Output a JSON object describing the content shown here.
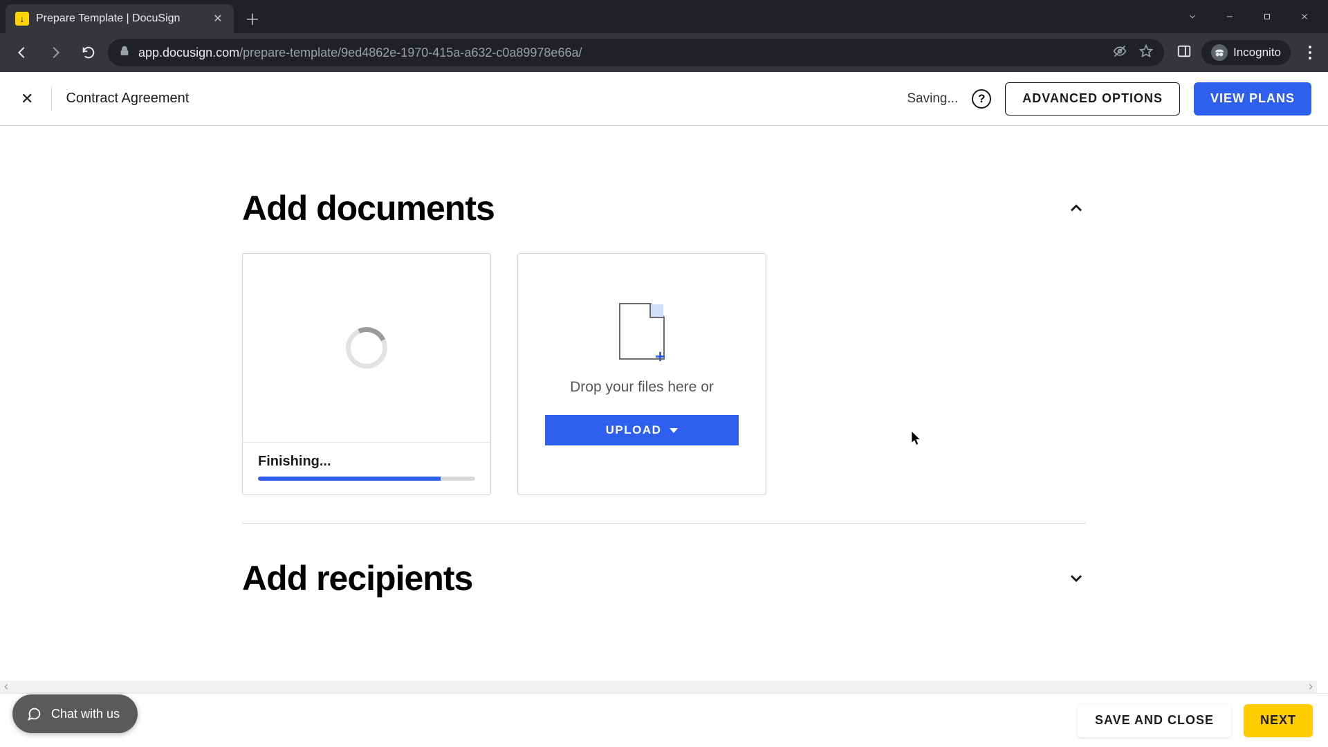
{
  "browser": {
    "tab_title": "Prepare Template | DocuSign",
    "url_host": "app.docusign.com",
    "url_path": "/prepare-template/9ed4862e-1970-415a-a632-c0a89978e66a/",
    "incognito_label": "Incognito"
  },
  "header": {
    "template_name": "Contract Agreement",
    "saving_label": "Saving...",
    "advanced_options_label": "ADVANCED OPTIONS",
    "view_plans_label": "VIEW PLANS"
  },
  "sections": {
    "add_documents": {
      "title": "Add documents",
      "uploading_status": "Finishing...",
      "upload_progress_percent": 84,
      "drop_hint": "Drop your files here or",
      "upload_button": "UPLOAD"
    },
    "add_recipients": {
      "title": "Add recipients"
    }
  },
  "footer": {
    "save_close_label": "SAVE AND CLOSE",
    "next_label": "NEXT"
  },
  "chat": {
    "label": "Chat with us"
  },
  "colors": {
    "primary_blue": "#2f5fef",
    "accent_yellow": "#ffcc00"
  }
}
